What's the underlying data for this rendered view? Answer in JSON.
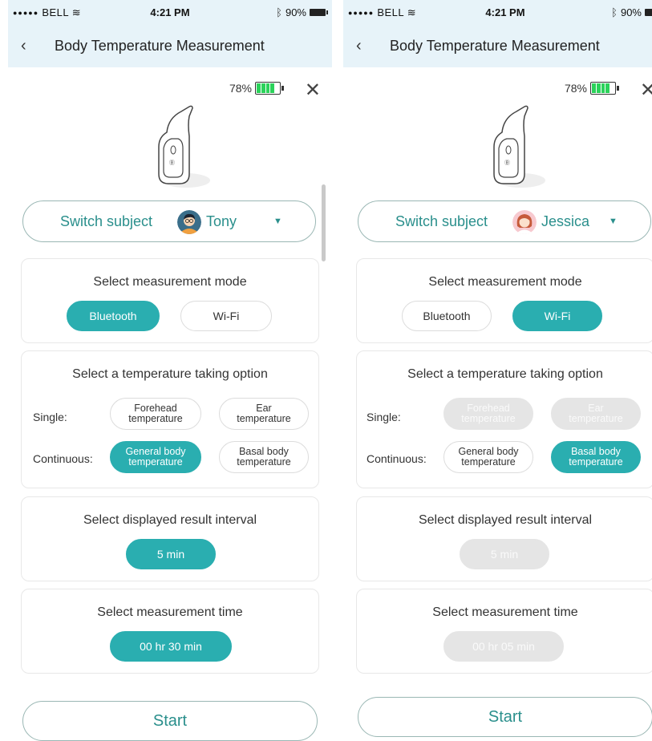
{
  "screens": [
    {
      "status": {
        "carrier": "BELL",
        "time": "4:21 PM",
        "battery": "90%"
      },
      "title": "Body Temperature Measurement",
      "device_battery": "78%",
      "subject": {
        "label": "Switch subject",
        "name": "Tony",
        "avatar": "male-avatar"
      },
      "mode": {
        "title": "Select measurement mode",
        "bluetooth": "Bluetooth",
        "wifi": "Wi-Fi",
        "selected": "Bluetooth"
      },
      "temp": {
        "title": "Select a temperature taking option",
        "single_label": "Single:",
        "continuous_label": "Continuous:",
        "forehead": "Forehead temperature",
        "ear": "Ear temperature",
        "general": "General body temperature",
        "basal": "Basal body temperature",
        "selected": "General body temperature"
      },
      "interval": {
        "title": "Select displayed result interval",
        "value": "5 min",
        "enabled": true
      },
      "time": {
        "title": "Select measurement time",
        "value": "00 hr 30 min",
        "enabled": true
      },
      "start": "Start"
    },
    {
      "status": {
        "carrier": "BELL",
        "time": "4:21 PM",
        "battery": "90%"
      },
      "title": "Body Temperature Measurement",
      "device_battery": "78%",
      "subject": {
        "label": "Switch subject",
        "name": "Jessica",
        "avatar": "female-avatar"
      },
      "mode": {
        "title": "Select measurement mode",
        "bluetooth": "Bluetooth",
        "wifi": "Wi-Fi",
        "selected": "Wi-Fi"
      },
      "temp": {
        "title": "Select a temperature taking option",
        "single_label": "Single:",
        "continuous_label": "Continuous:",
        "forehead": "Forehead temperature",
        "ear": "Ear temperature",
        "general": "General body temperature",
        "basal": "Basal body temperature",
        "selected": "Basal body temperature"
      },
      "interval": {
        "title": "Select displayed result interval",
        "value": "5 min",
        "enabled": false
      },
      "time": {
        "title": "Select measurement time",
        "value": "00 hr 05 min",
        "enabled": false
      },
      "start": "Start"
    }
  ],
  "colors": {
    "accent": "#2aaeb0",
    "header_bg": "#e7f3f9",
    "disabled": "#e5e5e5",
    "battery_green": "#2bd25a"
  }
}
